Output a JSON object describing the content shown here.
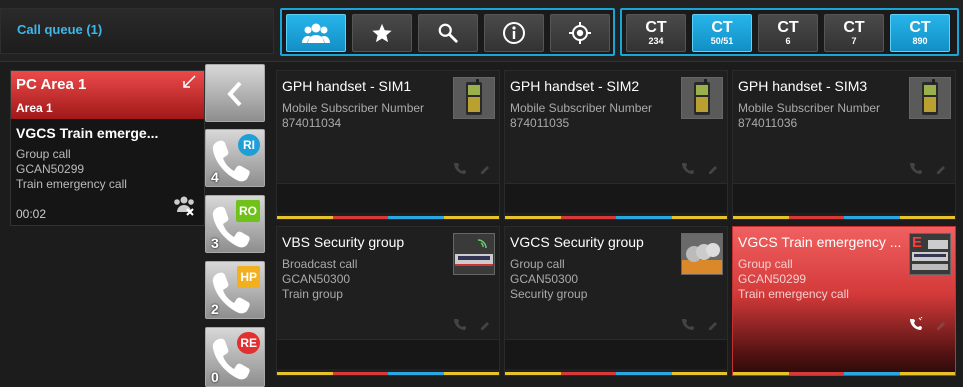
{
  "queue": {
    "title": "Call queue (1)"
  },
  "toolbar": {
    "buttons": [
      {
        "icon": "group-icon",
        "active": true
      },
      {
        "icon": "star-icon",
        "active": false
      },
      {
        "icon": "search-icon",
        "active": false
      },
      {
        "icon": "info-icon",
        "active": false
      },
      {
        "icon": "locate-icon",
        "active": false
      }
    ],
    "ct_buttons": [
      {
        "main": "CT",
        "sub": "234",
        "active": false
      },
      {
        "main": "CT",
        "sub": "50/51",
        "active": true
      },
      {
        "main": "CT",
        "sub": "6",
        "active": false
      },
      {
        "main": "CT",
        "sub": "7",
        "active": false
      },
      {
        "main": "CT",
        "sub": "890",
        "active": true
      }
    ]
  },
  "active_call": {
    "title": "PC Area 1",
    "area": "Area 1",
    "name": "VGCS Train emerge...",
    "type": "Group call",
    "id": "GCAN50299",
    "desc": "Train emergency call",
    "timer": "00:02"
  },
  "priority": [
    {
      "badge": "RI",
      "count": "4",
      "color": "#1e9fd6"
    },
    {
      "badge": "RO",
      "count": "3",
      "color": "#6fc21a"
    },
    {
      "badge": "HP",
      "count": "2",
      "color": "#f2b01f"
    },
    {
      "badge": "RE",
      "count": "0",
      "color": "#e03030"
    }
  ],
  "tiles": [
    {
      "title": "GPH handset - SIM1",
      "line1": "Mobile Subscriber Number",
      "line2": "874011034",
      "line3": "",
      "thumb": "handset",
      "alert": false
    },
    {
      "title": "GPH handset - SIM2",
      "line1": "Mobile Subscriber Number",
      "line2": "874011035",
      "line3": "",
      "thumb": "handset",
      "alert": false
    },
    {
      "title": "GPH handset - SIM3",
      "line1": "Mobile Subscriber Number",
      "line2": "874011036",
      "line3": "",
      "thumb": "handset",
      "alert": false
    },
    {
      "title": "VBS Security group",
      "line1": "Broadcast call",
      "line2": "GCAN50300",
      "line3": "Train group",
      "thumb": "train",
      "alert": false
    },
    {
      "title": "VGCS Security group",
      "line1": "Group call",
      "line2": "GCAN50300",
      "line3": "Security group",
      "thumb": "people",
      "alert": false
    },
    {
      "title": "VGCS Train emergency ...",
      "line1": "Group call",
      "line2": "GCAN50299",
      "line3": "Train emergency call",
      "thumb": "train-emergency",
      "thumb_label": "E",
      "alert": true
    }
  ],
  "colors": {
    "accent": "#1aa5d8",
    "alert": "#e04444",
    "stripe": [
      "#e8c22a",
      "#d83a3a",
      "#2aa6e0",
      "#e8c22a"
    ]
  }
}
